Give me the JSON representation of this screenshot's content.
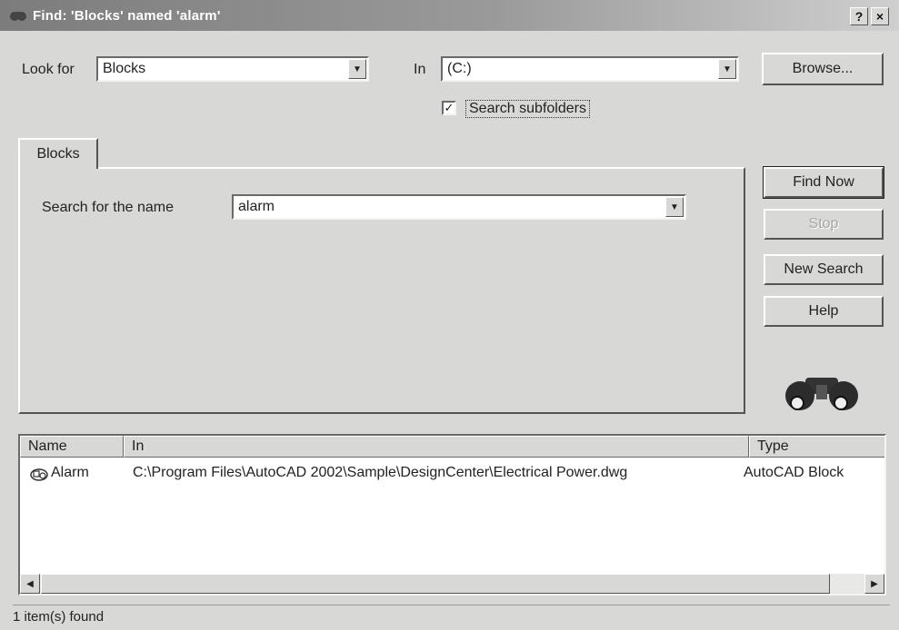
{
  "window": {
    "title": "Find: 'Blocks' named 'alarm'",
    "help_glyph": "?",
    "close_glyph": "×"
  },
  "look_for": {
    "label": "Look for",
    "value": "Blocks"
  },
  "in_field": {
    "label": "In",
    "value": "(C:)"
  },
  "browse_label": "Browse...",
  "search_subfolders": {
    "label": "Search subfolders",
    "checked": true,
    "check_glyph": "✓"
  },
  "tab": {
    "label": "Blocks"
  },
  "search_name": {
    "label": "Search for the name",
    "value": "alarm"
  },
  "buttons": {
    "find_now": "Find Now",
    "stop": "Stop",
    "new_search": "New Search",
    "help": "Help"
  },
  "results": {
    "columns": [
      "Name",
      "In",
      "Type"
    ],
    "rows": [
      {
        "name": "Alarm",
        "in": "C:\\Program Files\\AutoCAD 2002\\Sample\\DesignCenter\\Electrical Power.dwg",
        "type": "AutoCAD Block"
      }
    ]
  },
  "status": "1 item(s) found",
  "icons": {
    "dropdown": "chevron-down-icon",
    "binoculars": "binoculars-icon",
    "block": "block-icon"
  }
}
